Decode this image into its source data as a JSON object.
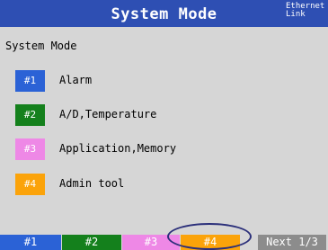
{
  "header": {
    "title": "System Mode",
    "network_status_line1": "Ethernet",
    "network_status_line2": "Link"
  },
  "main": {
    "section_label": "System Mode",
    "menu": [
      {
        "key": "#1",
        "label": "Alarm",
        "color": "#2b62d6"
      },
      {
        "key": "#2",
        "label": "A/D,Temperature",
        "color": "#14801c"
      },
      {
        "key": "#3",
        "label": "Application,Memory",
        "color": "#ee88e6"
      },
      {
        "key": "#4",
        "label": "Admin tool",
        "color": "#fba30a"
      }
    ]
  },
  "softkeys": [
    {
      "label": "#1",
      "color": "#2b62d6"
    },
    {
      "label": "#2",
      "color": "#14801c"
    },
    {
      "label": "#3",
      "color": "#ee88e6"
    },
    {
      "label": "#4",
      "color": "#fba30a"
    },
    {
      "label": "Next 1/3",
      "color": "#8c8c8c"
    }
  ],
  "colors": {
    "title_bar": "#2e4fb3",
    "background": "#d6d6d6",
    "highlight_ring": "#2b2f7a"
  }
}
